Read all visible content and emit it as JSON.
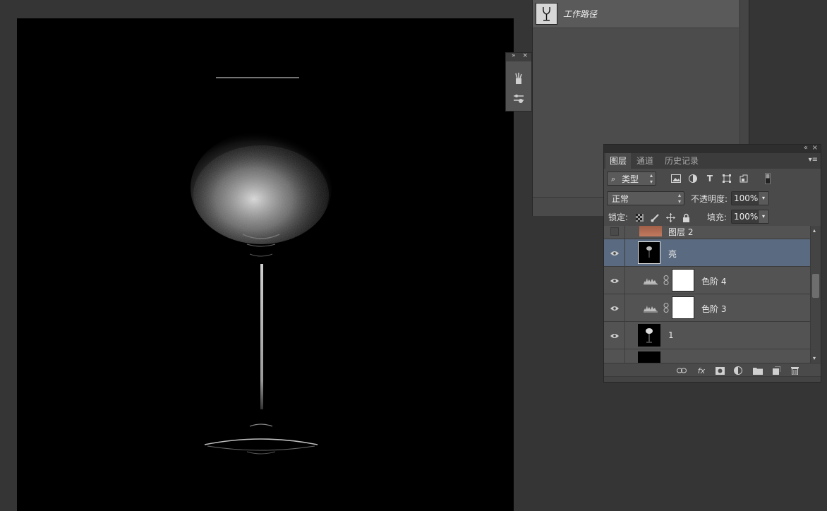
{
  "paths_panel": {
    "path_name": "工作路径"
  },
  "layers_panel": {
    "tabs": [
      "图层",
      "通道",
      "历史记录"
    ],
    "filter_label": "类型",
    "blend_mode": "正常",
    "opacity_label": "不透明度:",
    "opacity_value": "100%",
    "lock_label": "锁定:",
    "fill_label": "填充:",
    "fill_value": "100%",
    "layers": [
      {
        "name": "图层 2",
        "visible": false,
        "selected": false,
        "kind": "pixel"
      },
      {
        "name": "亮",
        "visible": true,
        "selected": true,
        "kind": "pixel"
      },
      {
        "name": "色阶 4",
        "visible": true,
        "selected": false,
        "kind": "levels-adjustment"
      },
      {
        "name": "色阶 3",
        "visible": true,
        "selected": false,
        "kind": "levels-adjustment"
      },
      {
        "name": "1",
        "visible": true,
        "selected": false,
        "kind": "pixel"
      },
      {
        "name": "",
        "visible": true,
        "selected": false,
        "kind": "pixel"
      }
    ]
  },
  "colors": {
    "selection": "#5a6a80",
    "panel": "#4a4a4a",
    "workspace": "#353535",
    "canvas": "#000000"
  }
}
